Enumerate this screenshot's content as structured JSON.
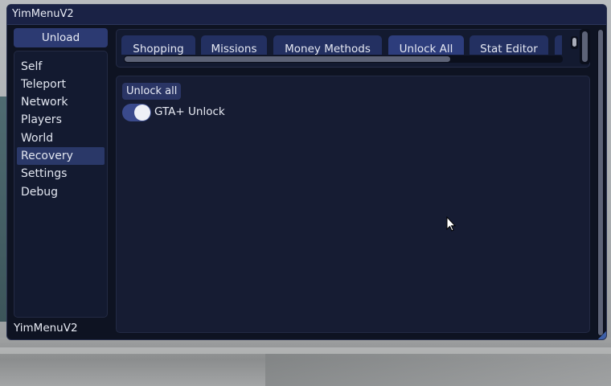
{
  "window": {
    "title": "YimMenuV2",
    "footer": "YimMenuV2"
  },
  "sidebar": {
    "unload_label": "Unload",
    "items": [
      {
        "label": "Self"
      },
      {
        "label": "Teleport"
      },
      {
        "label": "Network"
      },
      {
        "label": "Players"
      },
      {
        "label": "World"
      },
      {
        "label": "Recovery",
        "active": true
      },
      {
        "label": "Settings"
      },
      {
        "label": "Debug"
      }
    ]
  },
  "tabs": [
    {
      "label": "Shopping"
    },
    {
      "label": "Missions"
    },
    {
      "label": "Money Methods"
    },
    {
      "label": "Unlock All",
      "active": true
    },
    {
      "label": "Stat Editor"
    },
    {
      "label": ""
    }
  ],
  "content": {
    "unlock_button": "Unlock all",
    "toggle": {
      "label": "GTA+ Unlock",
      "on": true
    }
  },
  "colors": {
    "accent": "#2d3d7c",
    "background": "#0e1322",
    "panel": "#161c33"
  }
}
